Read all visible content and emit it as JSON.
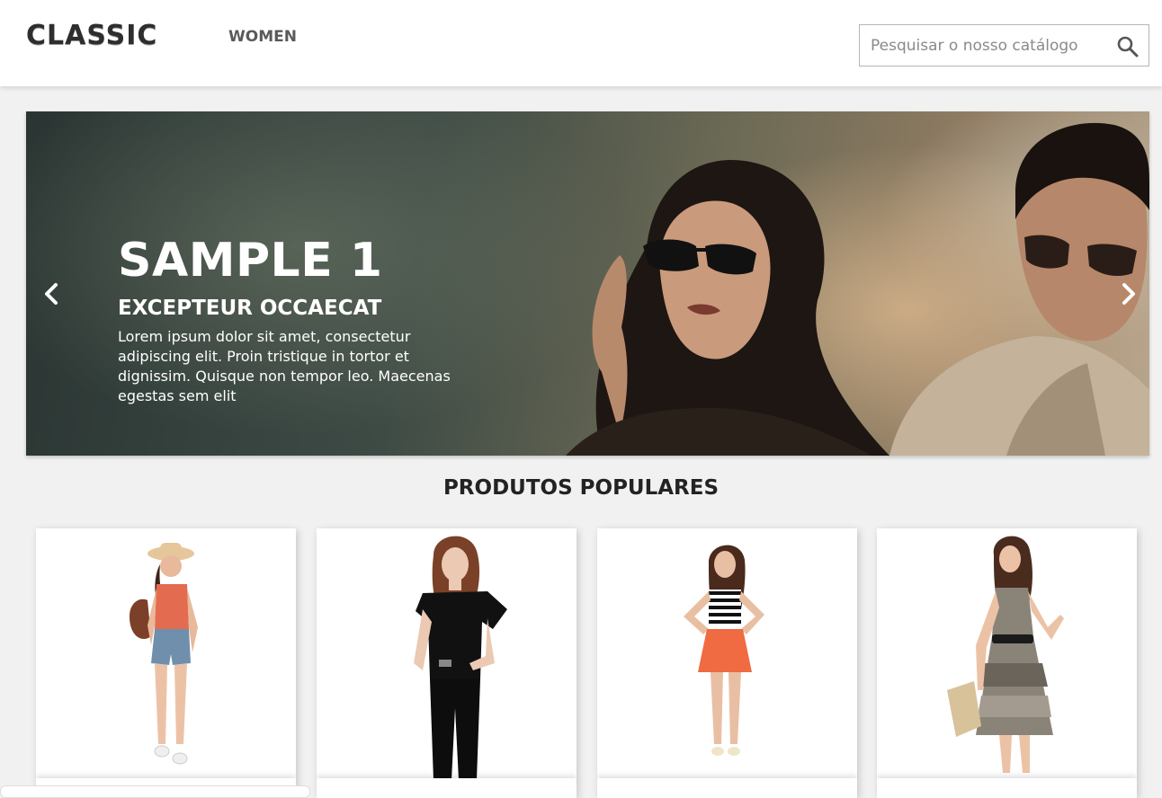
{
  "header": {
    "logo": "CLASSIC",
    "nav": [
      {
        "label": "WOMEN"
      }
    ],
    "search": {
      "placeholder": "Pesquisar o nosso catálogo",
      "value": ""
    }
  },
  "carousel": {
    "slide_title": "SAMPLE 1",
    "slide_subtitle": "EXCEPTEUR OCCAECAT",
    "slide_text": "Lorem ipsum dolor sit amet, consectetur adipiscing elit. Proin tristique in tortor et dignissim. Quisque non tempor leo. Maecenas egestas sem elit"
  },
  "featured": {
    "title": "PRODUTOS POPULARES"
  },
  "colors": {
    "header_bg": "#ffffff",
    "page_bg": "#f1f1f1",
    "text_dark": "#232323",
    "nav_text": "#5a5a5a"
  },
  "icons": [
    "search-icon",
    "chevron-left-icon",
    "chevron-right-icon"
  ]
}
